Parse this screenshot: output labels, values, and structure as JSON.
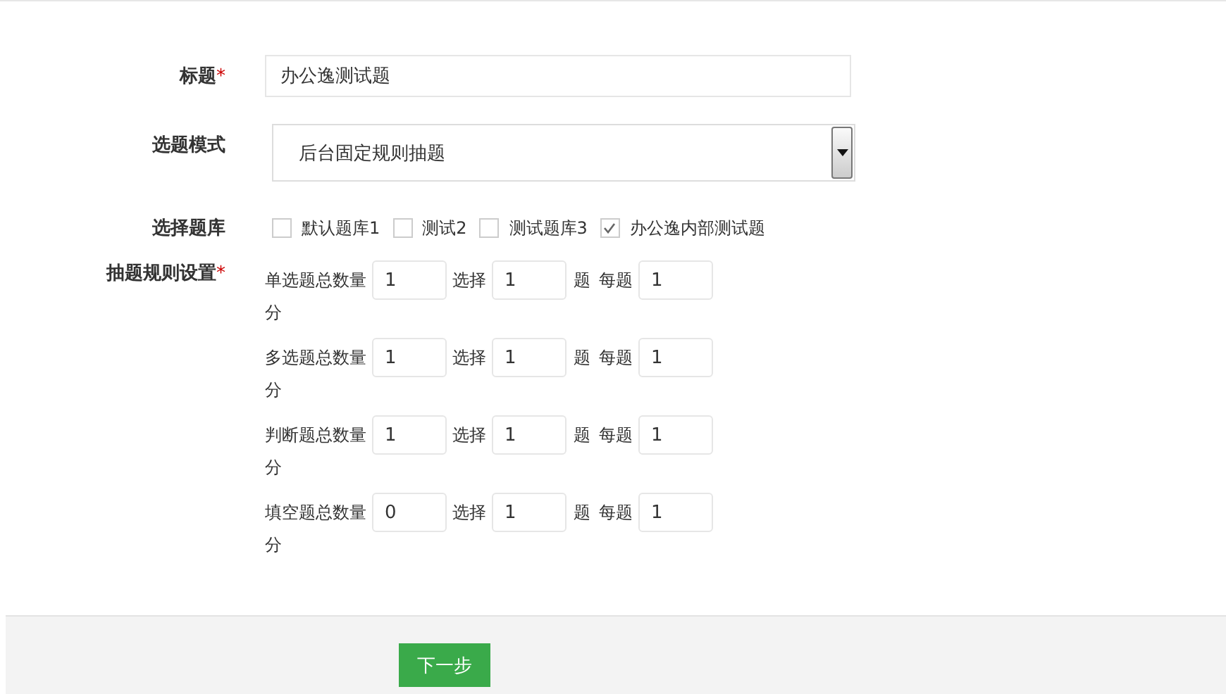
{
  "title_field": {
    "label": "标题",
    "required_mark": "*",
    "value": "办公逸测试题"
  },
  "mode_field": {
    "label": "选题模式",
    "value": "后台固定规则抽题"
  },
  "bank_field": {
    "label": "选择题库",
    "options": [
      {
        "label": "默认题库1",
        "checked": false
      },
      {
        "label": "测试2",
        "checked": false
      },
      {
        "label": "测试题库3",
        "checked": false
      },
      {
        "label": "办公逸内部测试题",
        "checked": true
      }
    ]
  },
  "rules_field": {
    "label": "抽题规则设置",
    "required_mark": "*",
    "rules": [
      {
        "label": "单选题总数量",
        "count": "1",
        "select_label": "选择",
        "select": "1",
        "unit": "题",
        "score_label": "每题",
        "score": "1",
        "score_unit": "分"
      },
      {
        "label": "多选题总数量",
        "count": "1",
        "select_label": "选择",
        "select": "1",
        "unit": "题",
        "score_label": "每题",
        "score": "1",
        "score_unit": "分"
      },
      {
        "label": "判断题总数量",
        "count": "1",
        "select_label": "选择",
        "select": "1",
        "unit": "题",
        "score_label": "每题",
        "score": "1",
        "score_unit": "分"
      },
      {
        "label": "填空题总数量",
        "count": "0",
        "select_label": "选择",
        "select": "1",
        "unit": "题",
        "score_label": "每题",
        "score": "1",
        "score_unit": "分"
      }
    ]
  },
  "next_button": "下一步"
}
